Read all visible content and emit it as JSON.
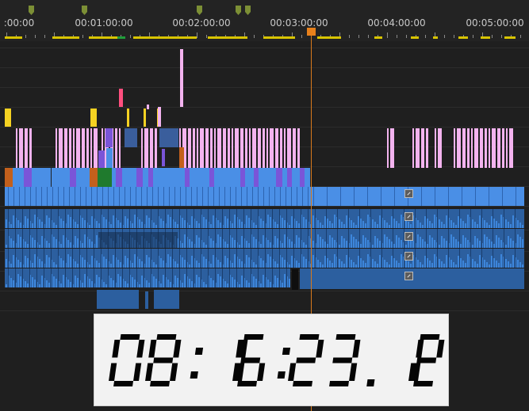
{
  "ruler": {
    "timecodes": [
      ":00:00",
      "00:01:00:00",
      "00:02:00:00",
      "00:03:00:00",
      "00:04:00:00",
      "00:05:00:00"
    ],
    "marker_color": "#7c8f35",
    "yellow_strip_color": "#d8c400"
  },
  "playhead": {
    "color": "#e8811b"
  },
  "tracks": {
    "video_colors": {
      "pink": "#f3b3ef",
      "magenta": "#ff4f7e",
      "yellow": "#f5d222",
      "purple": "#7a55d8",
      "blue": "#4a8fe6",
      "orange": "#c3601c",
      "green": "#1f7a2d",
      "steel": "#3a5e9c"
    },
    "audio_color": "#3d86db"
  },
  "clock": {
    "display": "08: 16:23. 12",
    "digits": [
      "0",
      "8",
      ":",
      " ",
      "1",
      "6",
      ":",
      "2",
      "3",
      ".",
      " ",
      "1",
      "2"
    ]
  }
}
